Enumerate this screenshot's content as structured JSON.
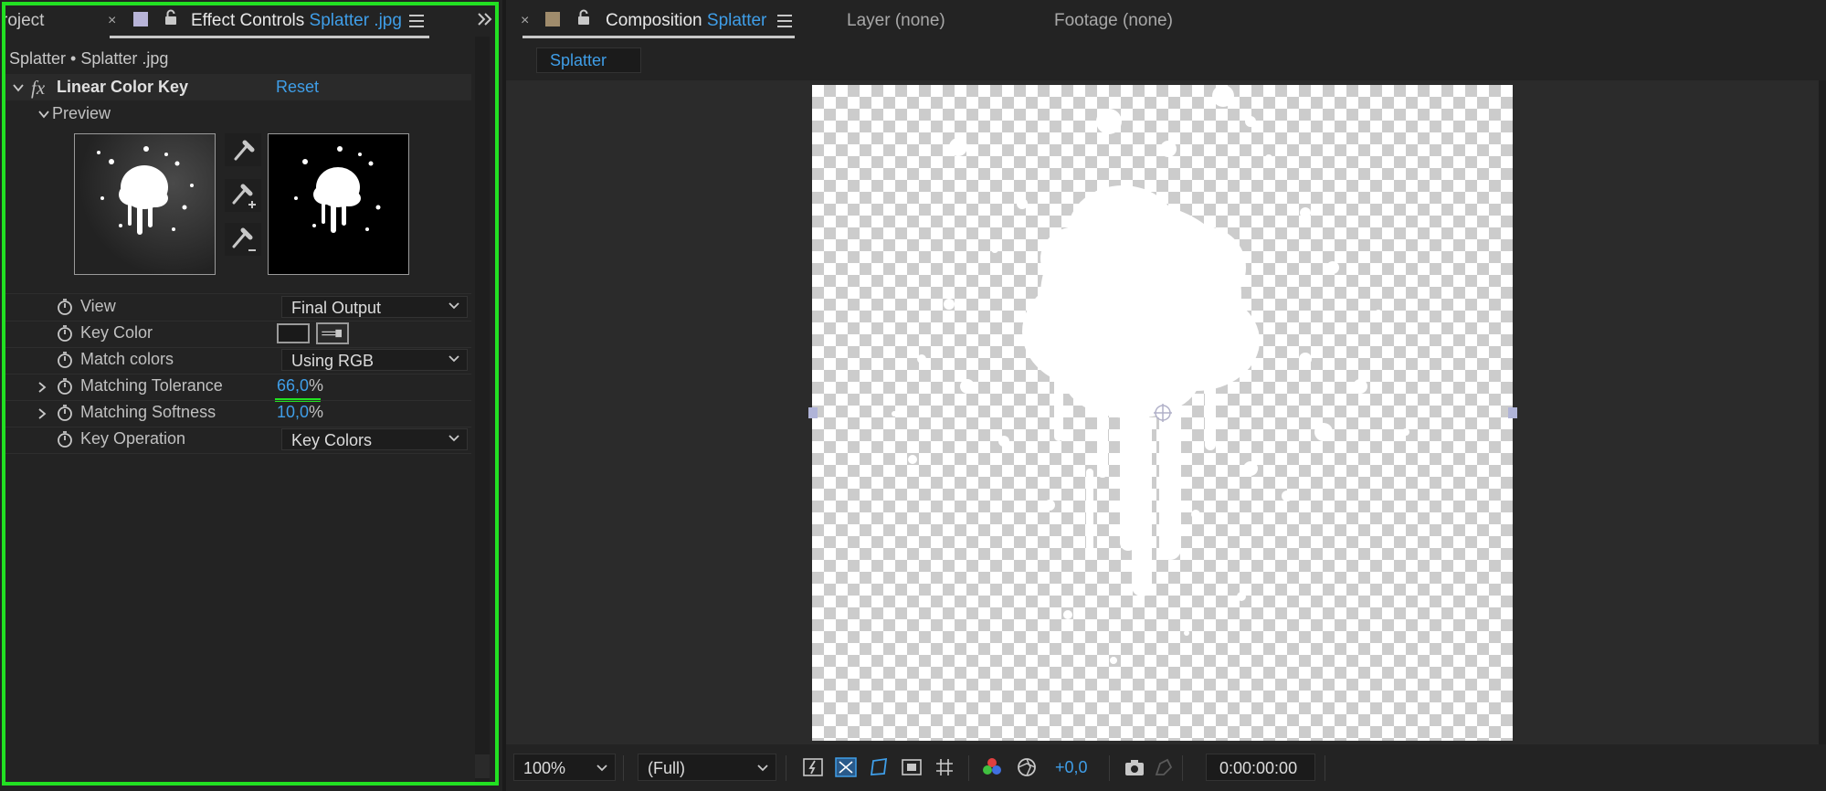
{
  "left_panel": {
    "tabs": {
      "project_label": "roject",
      "effect_controls_label": "Effect Controls",
      "effect_controls_target": "Splatter .jpg"
    },
    "breadcrumb": "Splatter • Splatter .jpg",
    "effect": {
      "fx_label": "fx",
      "name": "Linear Color Key",
      "reset_label": "Reset",
      "preview_label": "Preview"
    },
    "properties": {
      "view": {
        "label": "View",
        "value": "Final Output"
      },
      "key_color": {
        "label": "Key Color"
      },
      "match_colors": {
        "label": "Match colors",
        "value": "Using RGB"
      },
      "matching_tolerance": {
        "label": "Matching Tolerance",
        "value": "66,0",
        "unit": "%"
      },
      "matching_softness": {
        "label": "Matching Softness",
        "value": "10,0",
        "unit": "%"
      },
      "key_operation": {
        "label": "Key Operation",
        "value": "Key Colors"
      }
    }
  },
  "right_panel": {
    "tabs": {
      "composition_label": "Composition",
      "composition_name": "Splatter",
      "layer_label": "Layer",
      "layer_value": "(none)",
      "footage_label": "Footage",
      "footage_value": "(none)"
    },
    "sub_tab": "Splatter",
    "bottom_bar": {
      "zoom": "100%",
      "resolution": "(Full)",
      "exposure": "+0,0",
      "timecode": "0:00:00:00"
    }
  },
  "colors": {
    "accent_blue": "#3f9ee8",
    "highlight_green": "#22e022",
    "panel_bg": "#232323",
    "viewer_bg": "#2b2b2b",
    "ec_swatch": "#b8b4d8",
    "comp_swatch": "#a08c6c"
  }
}
